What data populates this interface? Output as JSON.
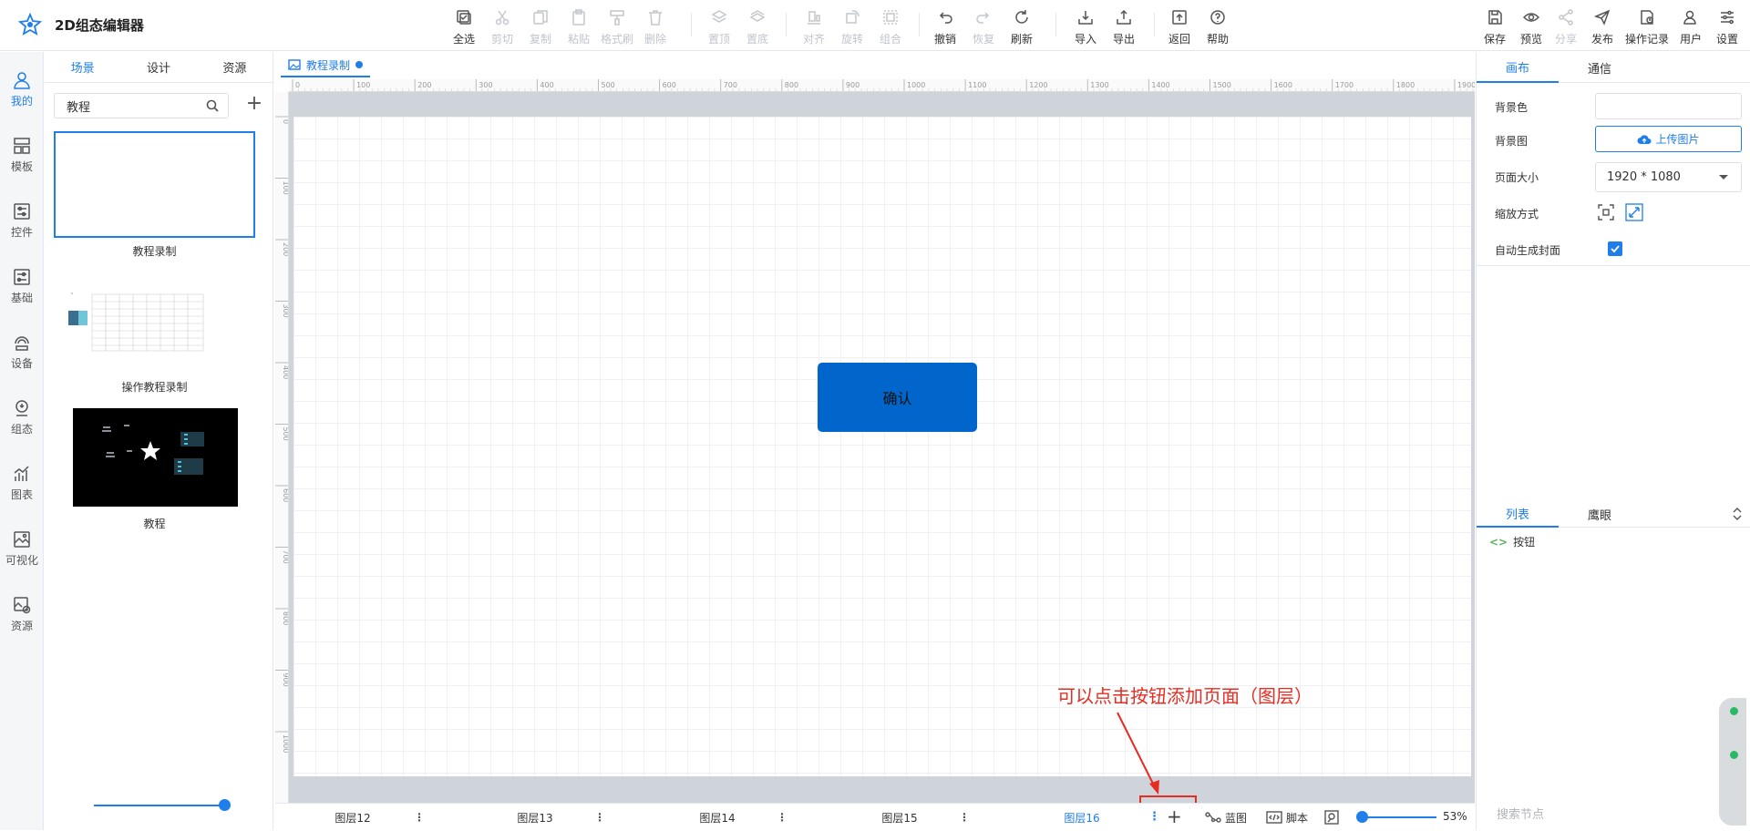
{
  "app": {
    "title": "2D组态编辑器"
  },
  "toolbar": {
    "items": [
      {
        "label": "全选",
        "icon": "select-all-icon",
        "disabled": false
      },
      {
        "label": "剪切",
        "icon": "cut-icon",
        "disabled": true
      },
      {
        "label": "复制",
        "icon": "copy-icon",
        "disabled": true
      },
      {
        "label": "粘贴",
        "icon": "paste-icon",
        "disabled": true
      },
      {
        "label": "格式刷",
        "icon": "format-brush-icon",
        "disabled": true
      },
      {
        "label": "删除",
        "icon": "delete-icon",
        "disabled": true
      },
      {
        "label": "置顶",
        "icon": "bring-top-icon",
        "disabled": true
      },
      {
        "label": "置底",
        "icon": "send-bottom-icon",
        "disabled": true
      },
      {
        "label": "对齐",
        "icon": "align-icon",
        "disabled": true
      },
      {
        "label": "旋转",
        "icon": "rotate-icon",
        "disabled": true
      },
      {
        "label": "组合",
        "icon": "group-icon",
        "disabled": true
      },
      {
        "label": "撤销",
        "icon": "undo-icon",
        "disabled": false
      },
      {
        "label": "恢复",
        "icon": "redo-icon",
        "disabled": true
      },
      {
        "label": "刷新",
        "icon": "refresh-icon",
        "disabled": false
      },
      {
        "label": "导入",
        "icon": "import-icon",
        "disabled": false
      },
      {
        "label": "导出",
        "icon": "export-icon",
        "disabled": false
      },
      {
        "label": "返回",
        "icon": "back-icon",
        "disabled": false
      },
      {
        "label": "帮助",
        "icon": "help-icon",
        "disabled": false
      }
    ],
    "right_items": [
      {
        "label": "保存",
        "icon": "save-icon",
        "disabled": false
      },
      {
        "label": "预览",
        "icon": "preview-icon",
        "disabled": false
      },
      {
        "label": "分享",
        "icon": "share-icon",
        "disabled": true
      },
      {
        "label": "发布",
        "icon": "publish-icon",
        "disabled": false
      },
      {
        "label": "操作记录",
        "icon": "history-icon",
        "disabled": false
      },
      {
        "label": "用户",
        "icon": "user-icon",
        "disabled": false
      },
      {
        "label": "设置",
        "icon": "settings-icon",
        "disabled": false
      }
    ]
  },
  "leftnav": {
    "items": [
      {
        "label": "我的",
        "icon": "my-icon",
        "active": true
      },
      {
        "label": "模板",
        "icon": "template-icon",
        "active": false
      },
      {
        "label": "控件",
        "icon": "control-icon",
        "active": false
      },
      {
        "label": "基础",
        "icon": "basic-icon",
        "active": false
      },
      {
        "label": "设备",
        "icon": "device-icon",
        "active": false
      },
      {
        "label": "组态",
        "icon": "scada-icon",
        "active": false
      },
      {
        "label": "图表",
        "icon": "chart-icon",
        "active": false
      },
      {
        "label": "可视化",
        "icon": "visualization-icon",
        "active": false
      },
      {
        "label": "资源",
        "icon": "resource-icon",
        "active": false
      }
    ]
  },
  "scene_panel": {
    "tabs": [
      "场景",
      "设计",
      "资源"
    ],
    "search_value": "教程",
    "thumbnails": [
      {
        "caption": "教程录制"
      },
      {
        "caption": "操作教程录制"
      },
      {
        "caption": "教程"
      }
    ]
  },
  "editor": {
    "doc_tab": "教程录制",
    "ruler_h": [
      "0",
      "100",
      "200",
      "300",
      "400",
      "500",
      "600",
      "700",
      "800",
      "900",
      "1000",
      "1100",
      "1200",
      "1300",
      "1400",
      "1500",
      "1600",
      "1700",
      "1800",
      "1900"
    ],
    "ruler_v": [
      "0",
      "100",
      "200",
      "300",
      "400",
      "500",
      "600",
      "700",
      "800",
      "900",
      "1000"
    ],
    "button_text": "确认",
    "annotation": "可以点击按钮添加页面（图层）"
  },
  "layerbar": {
    "layers": [
      {
        "name": "图层12",
        "active": false
      },
      {
        "name": "图层13",
        "active": false
      },
      {
        "name": "图层14",
        "active": false
      },
      {
        "name": "图层15",
        "active": false
      },
      {
        "name": "图层16",
        "active": true
      }
    ],
    "blueprint_label": "蓝图",
    "script_label": "脚本",
    "zoom": "53%"
  },
  "right_panel": {
    "tabs": [
      "画布",
      "通信"
    ],
    "bg_color_label": "背景色",
    "bg_image_label": "背景图",
    "upload_label": "上传图片",
    "page_size_label": "页面大小",
    "page_size_value": "1920 * 1080",
    "scale_label": "缩放方式",
    "auto_cover_label": "自动生成封面",
    "list_tabs": [
      "列表",
      "鹰眼"
    ],
    "tree_items": [
      "按钮"
    ],
    "search_placeholder": "搜索节点"
  },
  "colors": {
    "accent": "#1f7ee9",
    "button": "#0066cc",
    "annotation": "#e52d22"
  }
}
